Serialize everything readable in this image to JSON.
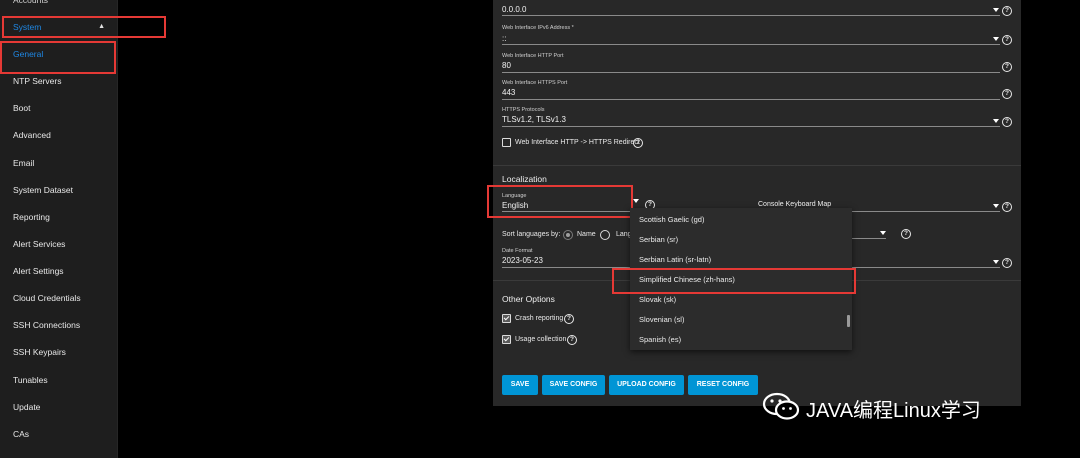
{
  "sidebar": {
    "top_item": "Accounts",
    "system": "System",
    "items": [
      "General",
      "NTP Servers",
      "Boot",
      "Advanced",
      "Email",
      "System Dataset",
      "Reporting",
      "Alert Services",
      "Alert Settings",
      "Cloud Credentials",
      "SSH Connections",
      "SSH Keypairs",
      "Tunables",
      "Update",
      "CAs"
    ]
  },
  "gui": {
    "ipv4_value": "0.0.0.0",
    "ipv6_label": "Web Interface IPv6 Address *",
    "ipv6_value": "::",
    "http_label": "Web Interface HTTP Port",
    "http_value": "80",
    "https_label": "Web Interface HTTPS Port",
    "https_value": "443",
    "protocols_label": "HTTPS Protocols",
    "protocols_value": "TLSv1.2, TLSv1.3",
    "redirect_label": "Web Interface HTTP -> HTTPS Redirect"
  },
  "localization": {
    "title": "Localization",
    "language_label": "Language",
    "language_value": "English",
    "keyboard_label": "Console Keyboard Map",
    "sort_label": "Sort languages by:",
    "sort_name": "Name",
    "sort_lang_partial": "Lang",
    "date_label": "Date Format",
    "date_value": "2023-05-23"
  },
  "dropdown": {
    "options": [
      "Scottish Gaelic (gd)",
      "Serbian (sr)",
      "Serbian Latin (sr-latn)",
      "Simplified Chinese (zh-hans)",
      "Slovak (sk)",
      "Slovenian (sl)",
      "Spanish (es)"
    ]
  },
  "other": {
    "title": "Other Options",
    "crash": "Crash reporting",
    "usage": "Usage collection"
  },
  "buttons": {
    "save": "SAVE",
    "save_config": "SAVE CONFIG",
    "upload_config": "UPLOAD CONFIG",
    "reset_config": "RESET CONFIG"
  },
  "watermark": {
    "text": "JAVA编程Linux学习"
  },
  "help_glyph": "?",
  "colors": {
    "accent": "#1e88e5",
    "button": "#0095d5",
    "highlight": "#e53935"
  }
}
